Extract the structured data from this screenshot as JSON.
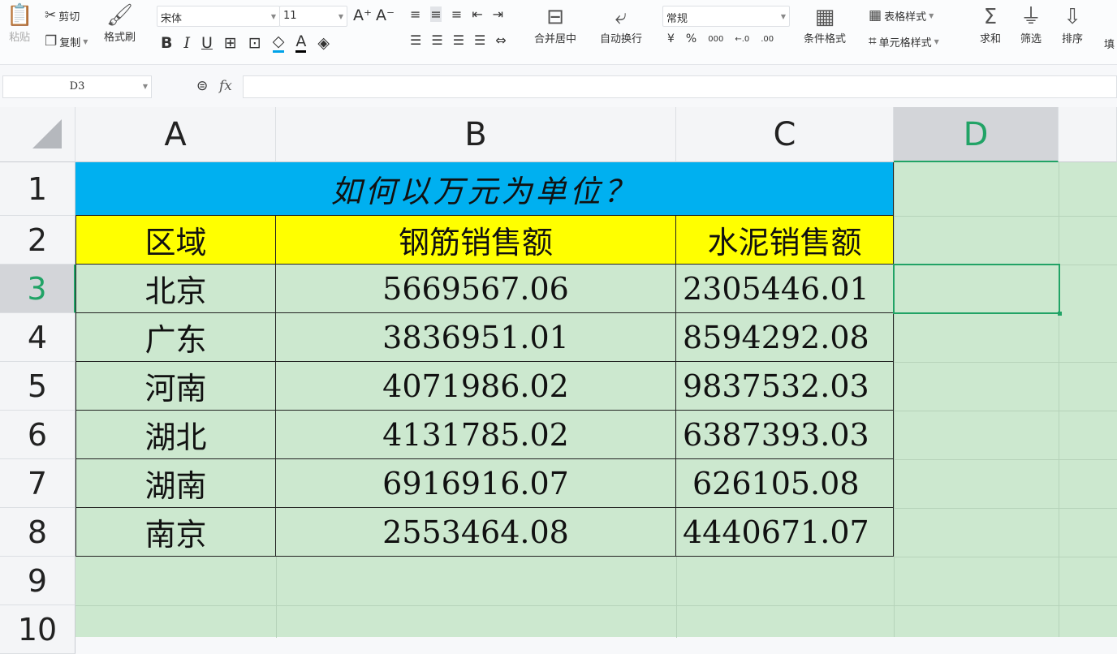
{
  "toolbar": {
    "paste": "粘贴",
    "cut": "剪切",
    "copy": "复制",
    "format_painter": "格式刷",
    "font_name": "宋体",
    "font_size": "11",
    "merge_center": "合并居中",
    "wrap_text": "自动换行",
    "number_format": "常规",
    "conditional_format": "条件格式",
    "table_style": "表格样式",
    "cell_style": "单元格样式",
    "sum": "求和",
    "filter": "筛选",
    "sort": "排序",
    "fill": "填",
    "currency": "¥",
    "percent": "%",
    "thousands": "000",
    "inc_decimal": "←.0",
    "dec_decimal": ".00"
  },
  "formula_bar": {
    "name_box": "D3",
    "fx": "fx",
    "value": ""
  },
  "columns": [
    "A",
    "B",
    "C",
    "D"
  ],
  "rows": [
    "1",
    "2",
    "3",
    "4",
    "5",
    "6",
    "7",
    "8",
    "9",
    "10"
  ],
  "sheet": {
    "title": "如何以万元为单位？",
    "headers": [
      "区域",
      "钢筋销售额",
      "水泥销售额"
    ],
    "data": [
      [
        "北京",
        "5669567.06",
        "2305446.01"
      ],
      [
        "广东",
        "3836951.01",
        "8594292.08"
      ],
      [
        "河南",
        "4071986.02",
        "9837532.03"
      ],
      [
        "湖北",
        "4131785.02",
        "6387393.03"
      ],
      [
        "湖南",
        "6916916.07",
        "626105.08"
      ],
      [
        "南京",
        "2553464.08",
        "4440671.07"
      ]
    ]
  },
  "colors": {
    "title_bg": "#00b0f0",
    "header_bg": "#ffff00",
    "sheet_bg": "#cce8cf",
    "accent": "#21a366"
  }
}
